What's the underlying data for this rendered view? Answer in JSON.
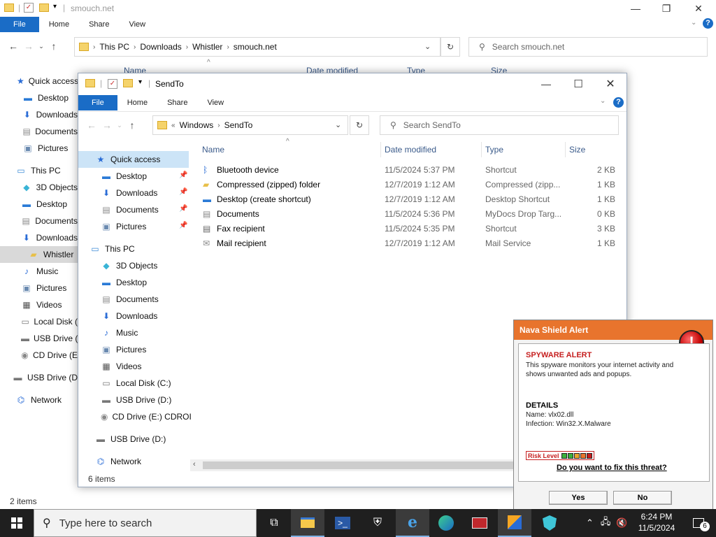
{
  "back_window": {
    "title": "smouch.net",
    "ribbon_tabs": [
      "File",
      "Home",
      "Share",
      "View"
    ],
    "breadcrumb": [
      "This PC",
      "Downloads",
      "Whistler",
      "smouch.net"
    ],
    "search_placeholder": "Search smouch.net",
    "columns": [
      "Name",
      "Date modified",
      "Type",
      "Size"
    ],
    "nav": [
      {
        "label": "Quick access",
        "icon": "star-icon"
      },
      {
        "label": "Desktop",
        "icon": "desktop-icon"
      },
      {
        "label": "Downloads",
        "icon": "download-icon"
      },
      {
        "label": "Documents",
        "icon": "document-icon"
      },
      {
        "label": "Pictures",
        "icon": "picture-icon"
      },
      {
        "label": "This PC",
        "icon": "computer-icon"
      },
      {
        "label": "3D Objects",
        "icon": "cube-icon"
      },
      {
        "label": "Desktop",
        "icon": "desktop-icon"
      },
      {
        "label": "Documents",
        "icon": "document-icon"
      },
      {
        "label": "Downloads",
        "icon": "download-icon"
      },
      {
        "label": "Whistler",
        "icon": "folder-icon"
      },
      {
        "label": "Music",
        "icon": "music-icon"
      },
      {
        "label": "Pictures",
        "icon": "picture-icon"
      },
      {
        "label": "Videos",
        "icon": "video-icon"
      },
      {
        "label": "Local Disk (",
        "icon": "disk-icon"
      },
      {
        "label": "USB Drive (",
        "icon": "usb-icon"
      },
      {
        "label": "CD Drive (E",
        "icon": "cd-icon"
      },
      {
        "label": "USB Drive (D",
        "icon": "usb-icon"
      },
      {
        "label": "Network",
        "icon": "network-icon"
      }
    ],
    "status": "2 items"
  },
  "front_window": {
    "title": "SendTo",
    "ribbon_tabs": [
      "File",
      "Home",
      "Share",
      "View"
    ],
    "breadcrumb_prefix": "«",
    "breadcrumb": [
      "Windows",
      "SendTo"
    ],
    "search_placeholder": "Search SendTo",
    "columns": [
      "Name",
      "Date modified",
      "Type",
      "Size"
    ],
    "nav": [
      {
        "label": "Quick access",
        "icon": "star-icon",
        "pinned": false
      },
      {
        "label": "Desktop",
        "icon": "desktop-icon",
        "pinned": true
      },
      {
        "label": "Downloads",
        "icon": "download-icon",
        "pinned": true
      },
      {
        "label": "Documents",
        "icon": "document-icon",
        "pinned": true
      },
      {
        "label": "Pictures",
        "icon": "picture-icon",
        "pinned": true
      },
      {
        "label": "This PC",
        "icon": "computer-icon",
        "pinned": false
      },
      {
        "label": "3D Objects",
        "icon": "cube-icon",
        "pinned": false
      },
      {
        "label": "Desktop",
        "icon": "desktop-icon",
        "pinned": false
      },
      {
        "label": "Documents",
        "icon": "document-icon",
        "pinned": false
      },
      {
        "label": "Downloads",
        "icon": "download-icon",
        "pinned": false
      },
      {
        "label": "Music",
        "icon": "music-icon",
        "pinned": false
      },
      {
        "label": "Pictures",
        "icon": "picture-icon",
        "pinned": false
      },
      {
        "label": "Videos",
        "icon": "video-icon",
        "pinned": false
      },
      {
        "label": "Local Disk (C:)",
        "icon": "disk-icon",
        "pinned": false
      },
      {
        "label": "USB Drive (D:)",
        "icon": "usb-icon",
        "pinned": false
      },
      {
        "label": "CD Drive (E:) CDROI",
        "icon": "cd-icon",
        "pinned": false
      },
      {
        "label": "USB Drive (D:)",
        "icon": "usb-icon",
        "pinned": false
      },
      {
        "label": "Network",
        "icon": "network-icon",
        "pinned": false
      }
    ],
    "files": [
      {
        "name": "Bluetooth device",
        "date": "11/5/2024 5:37 PM",
        "type": "Shortcut",
        "size": "2 KB",
        "icon": "bluetooth-icon"
      },
      {
        "name": "Compressed (zipped) folder",
        "date": "12/7/2019 1:12 AM",
        "type": "Compressed (zipp...",
        "size": "1 KB",
        "icon": "zip-folder-icon"
      },
      {
        "name": "Desktop (create shortcut)",
        "date": "12/7/2019 1:12 AM",
        "type": "Desktop Shortcut",
        "size": "1 KB",
        "icon": "desktop-icon"
      },
      {
        "name": "Documents",
        "date": "11/5/2024 5:36 PM",
        "type": "MyDocs Drop Targ...",
        "size": "0 KB",
        "icon": "document-icon"
      },
      {
        "name": "Fax recipient",
        "date": "11/5/2024 5:35 PM",
        "type": "Shortcut",
        "size": "3 KB",
        "icon": "fax-icon"
      },
      {
        "name": "Mail recipient",
        "date": "12/7/2019 1:12 AM",
        "type": "Mail Service",
        "size": "1 KB",
        "icon": "mail-icon"
      }
    ],
    "status": "6 items"
  },
  "alert": {
    "title": "Nava Shield Alert",
    "heading": "SPYWARE ALERT",
    "description": "This spyware monitors your internet activity and shows unwanted ads and popups.",
    "details_heading": "DETAILS",
    "name_line": "Name: vlx02.dll",
    "infection_line": "Infection: Win32.X.Malware",
    "risk_label": "Risk Level",
    "question": "Do you want to fix this threat?",
    "yes_label": "Yes",
    "no_label": "No",
    "accent_color": "#e8742d"
  },
  "taskbar": {
    "search_placeholder": "Type here to search",
    "time": "6:24 PM",
    "date": "11/5/2024",
    "notification_count": "6"
  }
}
